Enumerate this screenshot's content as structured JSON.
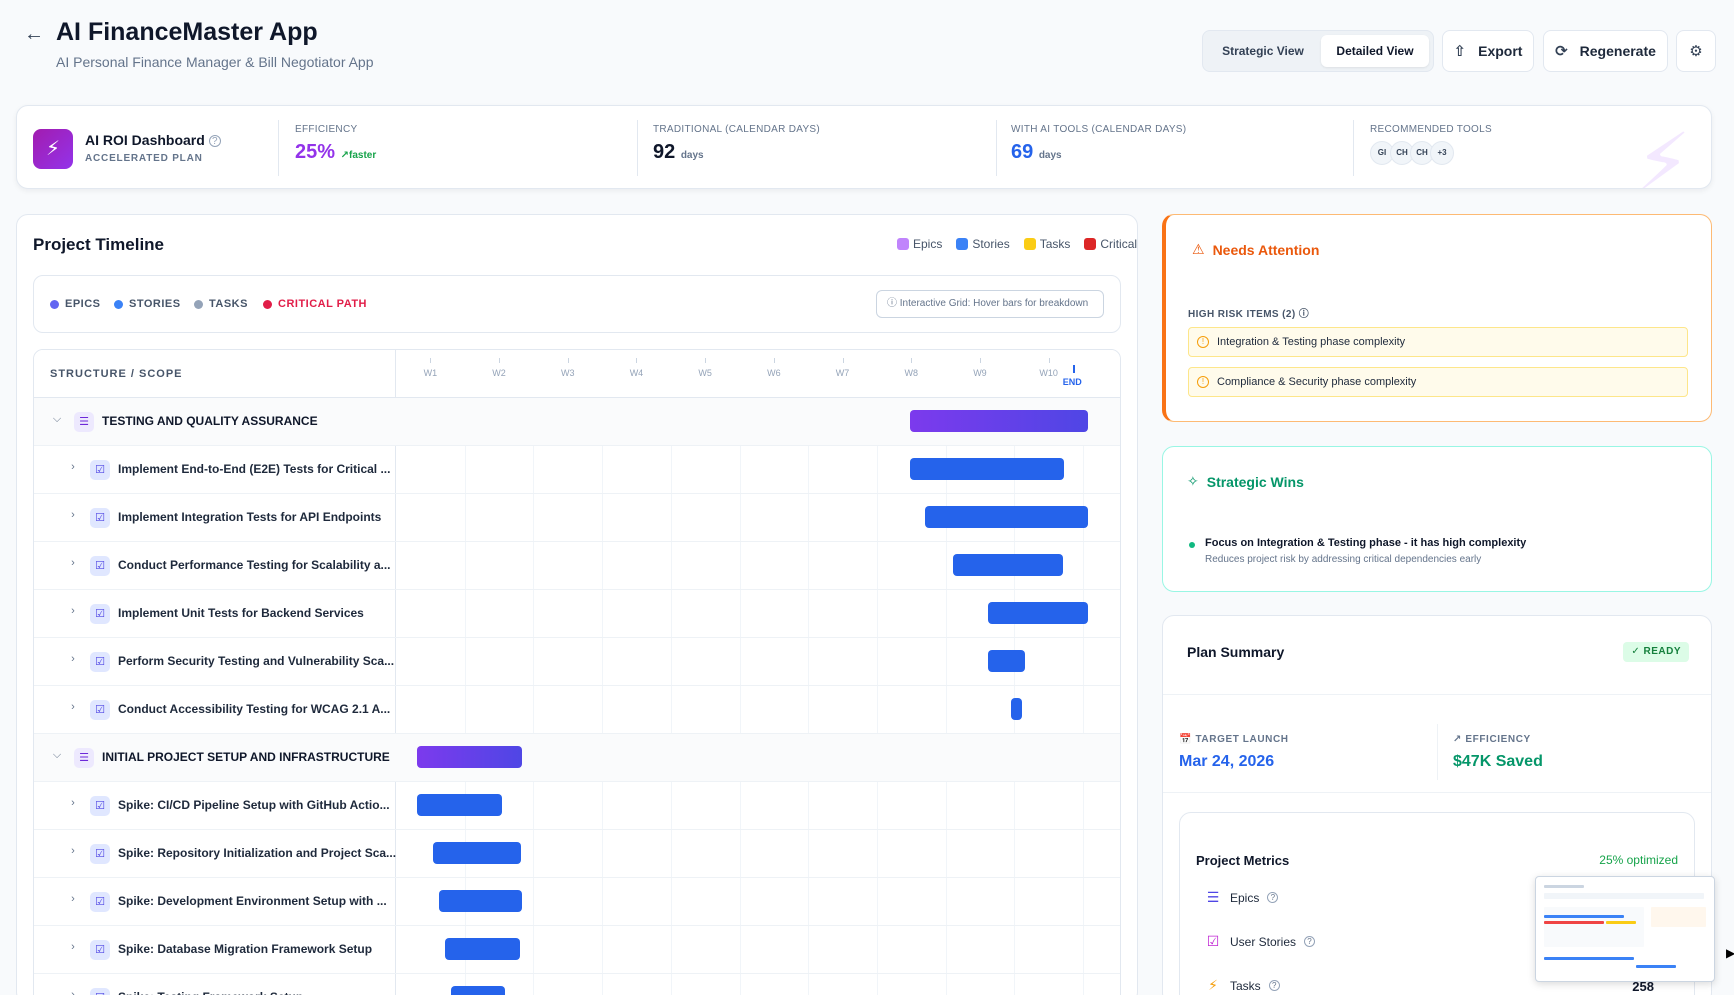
{
  "header": {
    "back_icon": "arrow-left-icon",
    "title": "AI FinanceMaster App",
    "subtitle": "AI Personal Finance Manager & Bill Negotiator App",
    "views": [
      "Strategic View",
      "Detailed View"
    ],
    "active_view": "Detailed View",
    "export_label": "Export",
    "regenerate_label": "Regenerate"
  },
  "roi": {
    "title": "AI ROI Dashboard",
    "subtitle": "ACCELERATED PLAN",
    "efficiency_label": "EFFICIENCY",
    "efficiency_value": "25%",
    "efficiency_note": "faster",
    "traditional_label": "TRADITIONAL (CALENDAR DAYS)",
    "traditional_value": "92",
    "traditional_unit": "days",
    "ai_label": "WITH AI TOOLS (CALENDAR DAYS)",
    "ai_value": "69",
    "ai_unit": "days",
    "tools_label": "RECOMMENDED TOOLS",
    "tools": [
      "GI",
      "CH",
      "CH",
      "+3"
    ]
  },
  "timeline": {
    "title": "Project Timeline",
    "legend": [
      {
        "label": "Epics",
        "color": "#c084fc"
      },
      {
        "label": "Stories",
        "color": "#3b82f6"
      },
      {
        "label": "Tasks",
        "color": "#facc15"
      },
      {
        "label": "Critical",
        "color": "#dc2626"
      }
    ],
    "filters": [
      {
        "label": "EPICS",
        "color": "#6366f1"
      },
      {
        "label": "STORIES",
        "color": "#3b82f6"
      },
      {
        "label": "TASKS",
        "color": "#94a3b8"
      },
      {
        "label": "CRITICAL PATH",
        "color": "#e11d48"
      }
    ],
    "hint": "Interactive Grid: Hover bars for breakdown",
    "scope_header": "STRUCTURE / SCOPE",
    "weeks": [
      "W1",
      "W2",
      "W3",
      "W4",
      "W5",
      "W6",
      "W7",
      "W8",
      "W9",
      "W10"
    ],
    "end_label": "END",
    "rows": [
      {
        "type": "epic",
        "label": "TESTING AND QUALITY ASSURANCE",
        "start": 7.48,
        "end": 10.08
      },
      {
        "type": "story",
        "label": "Implement End-to-End (E2E) Tests for Critical ...",
        "start": 7.48,
        "end": 9.72
      },
      {
        "type": "story",
        "label": "Implement Integration Tests for API Endpoints",
        "start": 7.7,
        "end": 10.08
      },
      {
        "type": "story",
        "label": "Conduct Performance Testing for Scalability a...",
        "start": 8.11,
        "end": 9.71
      },
      {
        "type": "story",
        "label": "Implement Unit Tests for Backend Services",
        "start": 8.61,
        "end": 10.08
      },
      {
        "type": "story",
        "label": "Perform Security Testing and Vulnerability Sca...",
        "start": 8.62,
        "end": 9.16
      },
      {
        "type": "story",
        "label": "Conduct Accessibility Testing for WCAG 2.1 A...",
        "start": 8.95,
        "end": 9.11
      },
      {
        "type": "epic",
        "label": "INITIAL PROJECT SETUP AND INFRASTRUCTURE",
        "start": 0.3,
        "end": 1.83
      },
      {
        "type": "story",
        "label": "Spike: CI/CD Pipeline Setup with GitHub Actio...",
        "start": 0.3,
        "end": 1.54
      },
      {
        "type": "story",
        "label": "Spike: Repository Initialization and Project Sca...",
        "start": 0.54,
        "end": 1.82
      },
      {
        "type": "story",
        "label": "Spike: Development Environment Setup with ...",
        "start": 0.63,
        "end": 1.83
      },
      {
        "type": "story",
        "label": "Spike: Database Migration Framework Setup",
        "start": 0.72,
        "end": 1.8
      },
      {
        "type": "story",
        "label": "Spike: Testing Framework Setup",
        "start": 0.8,
        "end": 1.58
      }
    ]
  },
  "attention": {
    "title": "Needs Attention",
    "subtitle": "HIGH RISK ITEMS (2)",
    "items": [
      "Integration & Testing phase complexity",
      "Compliance & Security phase complexity"
    ]
  },
  "wins": {
    "title": "Strategic Wins",
    "main": "Focus on Integration & Testing phase - it has high complexity",
    "sub": "Reduces project risk by addressing critical dependencies early"
  },
  "summary": {
    "title": "Plan Summary",
    "status": "READY",
    "launch_label": "TARGET LAUNCH",
    "launch_value": "Mar 24, 2026",
    "efficiency_label": "EFFICIENCY",
    "efficiency_value": "$47K Saved",
    "metrics_title": "Project Metrics",
    "metrics_optimized": "25% optimized",
    "metrics": [
      {
        "label": "Epics",
        "icon": "layers-icon",
        "value": ""
      },
      {
        "label": "User Stories",
        "icon": "list-check-icon",
        "value": ""
      },
      {
        "label": "Tasks",
        "icon": "bolt-icon",
        "value": "258"
      }
    ]
  },
  "colors": {
    "accent_purple": "#9333ea",
    "accent_blue": "#2563eb",
    "warning_orange": "#f97316",
    "success_green": "#059669"
  }
}
